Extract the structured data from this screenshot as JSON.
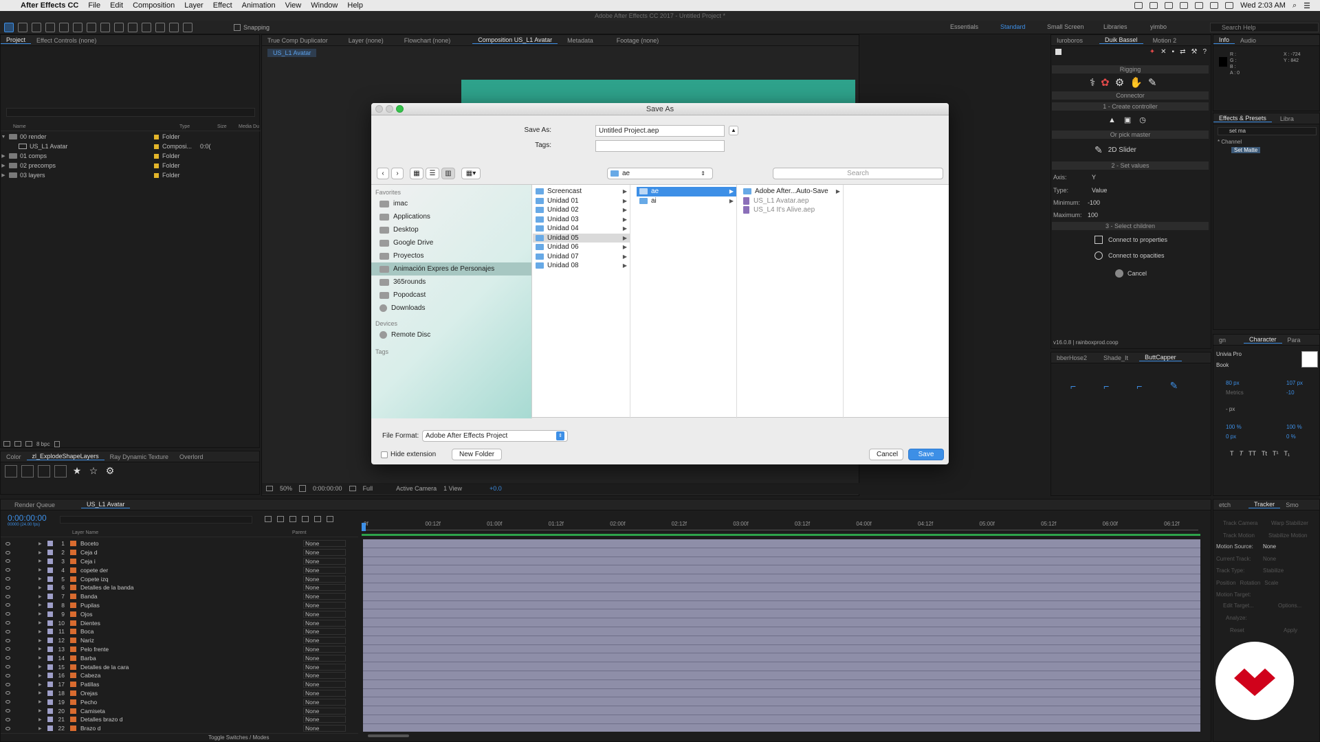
{
  "menubar": {
    "app_name": "After Effects CC",
    "menus": [
      "File",
      "Edit",
      "Composition",
      "Layer",
      "Effect",
      "Animation",
      "View",
      "Window",
      "Help"
    ],
    "clock": "Wed 2:03 AM"
  },
  "window_title": "Adobe After Effects CC 2017 - Untitled Project *",
  "toolbar": {
    "snapping_label": "Snapping",
    "workspaces": [
      "Essentials",
      "Standard",
      "Small Screen",
      "Libraries",
      "yimbo"
    ],
    "active_workspace": "Standard",
    "search_help_placeholder": "Search Help"
  },
  "project_panel": {
    "tabs": [
      "Project",
      "Effect Controls (none)"
    ],
    "columns": [
      "Name",
      "Type",
      "Size",
      "Media Du"
    ],
    "items": [
      {
        "name": "00 render",
        "type": "Folder",
        "size": "",
        "icon": "folder-icon",
        "indent": 0,
        "open": true
      },
      {
        "name": "US_L1 Avatar",
        "type": "Composi...",
        "size": "0:0(",
        "icon": "composition-icon",
        "indent": 1,
        "open": false
      },
      {
        "name": "01 comps",
        "type": "Folder",
        "size": "",
        "icon": "folder-icon",
        "indent": 0,
        "open": false
      },
      {
        "name": "02 precomps",
        "type": "Folder",
        "size": "",
        "icon": "folder-icon",
        "indent": 0,
        "open": false
      },
      {
        "name": "03 layers",
        "type": "Folder",
        "size": "",
        "icon": "folder-icon",
        "indent": 0,
        "open": false
      }
    ],
    "bpc": "8 bpc"
  },
  "effects_tabs": {
    "tabs": [
      "Color",
      "zl_ExplodeShapeLayers",
      "Ray Dynamic Texture",
      "Overlord"
    ],
    "active": "zl_ExplodeShapeLayers"
  },
  "viewer": {
    "tabs": [
      "True Comp Duplicator",
      "Layer (none)",
      "Flowchart (none)",
      "Composition US_L1 Avatar",
      "Metadata",
      "Footage (none)"
    ],
    "active_tab": "Composition US_L1 Avatar",
    "breadcrumb": "US_L1 Avatar",
    "bottom": {
      "zoom": "50%",
      "timecode": "0:00:00:00",
      "resolution": "Full",
      "camera": "Active Camera",
      "views": "1 View",
      "exposure": "+0.0"
    },
    "comp_color": "#2ea28b"
  },
  "dialog": {
    "title": "Save As",
    "save_as_label": "Save As:",
    "save_as_value": "Untitled Project.aep",
    "tags_label": "Tags:",
    "tags_value": "",
    "location": "ae",
    "search_placeholder": "Search",
    "sidebar": {
      "favorites_heading": "Favorites",
      "favorites": [
        "imac",
        "Applications",
        "Desktop",
        "Google Drive",
        "Proyectos",
        "Animación Expres de Personajes",
        "365rounds",
        "Popodcast",
        "Downloads"
      ],
      "selected": "Animación Expres de Personajes",
      "devices_heading": "Devices",
      "devices": [
        "Remote Disc"
      ],
      "tags_heading": "Tags"
    },
    "column1": {
      "items": [
        "Screencast",
        "Unidad 01",
        "Unidad 02",
        "Unidad 03",
        "Unidad 04",
        "Unidad 05",
        "Unidad 06",
        "Unidad 07",
        "Unidad 08"
      ],
      "selected": "Unidad 05"
    },
    "column2": {
      "items": [
        "ae",
        "ai"
      ],
      "selected": "ae"
    },
    "column3": {
      "items": [
        {
          "name": "Adobe After...Auto-Save",
          "kind": "folder"
        },
        {
          "name": "US_L1 Avatar.aep",
          "kind": "file"
        },
        {
          "name": "US_L4 It's Alive.aep",
          "kind": "file"
        }
      ]
    },
    "file_format_label": "File Format:",
    "file_format_value": "Adobe After Effects Project",
    "hide_extension_label": "Hide extension",
    "new_folder_label": "New Folder",
    "cancel_label": "Cancel",
    "save_label": "Save"
  },
  "duik": {
    "tabs": [
      "Iuroboros",
      "Duik Bassel",
      "Motion 2"
    ],
    "active": "Duik Bassel",
    "sections": {
      "rigging": "Rigging",
      "connector": "Connector",
      "step1": "1 - Create controller",
      "or_pick": "Or pick master",
      "slider": "2D Slider",
      "step2": "2 - Set values",
      "step3": "3 - Select children"
    },
    "axis_label": "Axis:",
    "axis_value": "Y",
    "type_label": "Type:",
    "type_value": "Value",
    "min_label": "Minimum:",
    "min_value": "-100",
    "max_label": "Maximum:",
    "max_value": "100",
    "connect_props": "Connect to properties",
    "connect_opacities": "Connect to opacities",
    "cancel": "Cancel",
    "version": "v16.0.8 | rainboxprod.coop"
  },
  "info_panel": {
    "tabs": [
      "Info",
      "Audio"
    ],
    "channels": [
      "R :",
      "G :",
      "B :",
      "A : 0"
    ],
    "x": "X : -724",
    "y": "Y : 842"
  },
  "effects_presets": {
    "tabs": [
      "Effects & Presets",
      "Libra"
    ],
    "search": "set ma",
    "category": "* Channel",
    "result": "Set Matte"
  },
  "buttcapper": {
    "tabs": [
      "bberHose2",
      "Shade_It",
      "ButtCapper"
    ],
    "active": "ButtCapper"
  },
  "character": {
    "tabs": [
      "gn",
      "Character",
      "Para"
    ],
    "font": "Univia Pro",
    "style": "Book",
    "size": "80 px",
    "leading": "107 px",
    "kerning": "Metrics",
    "tracking": "-10",
    "stroke": "- px",
    "vscale": "100 %",
    "hscale": "100 %",
    "baseline": "0 px",
    "tsume": "0 %"
  },
  "tracker": {
    "tabs": [
      "etch",
      "Tracker",
      "Smo"
    ],
    "buttons": [
      "Track Camera",
      "Warp Stabilizer",
      "Track Motion",
      "Stabilize Motion"
    ],
    "motion_source_label": "Motion Source:",
    "motion_source_value": "None",
    "current_track_label": "Current Track:",
    "current_track_value": "None",
    "track_type_label": "Track Type:",
    "track_type_value": "Stabilize",
    "checks": [
      "Position",
      "Rotation",
      "Scale"
    ],
    "motion_target": "Motion Target:",
    "edit_target": "Edit Target...",
    "options": "Options...",
    "analyze": "Analyze:",
    "reset": "Reset",
    "apply": "Apply"
  },
  "timeline": {
    "tabs": [
      "Render Queue",
      "US_L1 Avatar"
    ],
    "active_tab": "US_L1 Avatar",
    "timecode": "0:00:00:00",
    "fps": "00000 (24.00 fps)",
    "col_layer_name": "Layer Name",
    "col_parent": "Parent",
    "ruler": [
      "0f",
      "00:12f",
      "01:00f",
      "01:12f",
      "02:00f",
      "02:12f",
      "03:00f",
      "03:12f",
      "04:00f",
      "04:12f",
      "05:00f",
      "05:12f",
      "06:00f",
      "06:12f"
    ],
    "toggle_label": "Toggle Switches / Modes",
    "layers": [
      {
        "num": "1",
        "name": "Boceto",
        "parent": "None"
      },
      {
        "num": "2",
        "name": "Ceja d",
        "parent": "None"
      },
      {
        "num": "3",
        "name": "Ceja i",
        "parent": "None"
      },
      {
        "num": "4",
        "name": "copete der",
        "parent": "None"
      },
      {
        "num": "5",
        "name": "Copete izq",
        "parent": "None"
      },
      {
        "num": "6",
        "name": "Detalles de la banda",
        "parent": "None"
      },
      {
        "num": "7",
        "name": "Banda",
        "parent": "None"
      },
      {
        "num": "8",
        "name": "Pupilas",
        "parent": "None"
      },
      {
        "num": "9",
        "name": "Ojos",
        "parent": "None"
      },
      {
        "num": "10",
        "name": "Dientes",
        "parent": "None"
      },
      {
        "num": "11",
        "name": "Boca",
        "parent": "None"
      },
      {
        "num": "12",
        "name": "Nariz",
        "parent": "None"
      },
      {
        "num": "13",
        "name": "Pelo frente",
        "parent": "None"
      },
      {
        "num": "14",
        "name": "Barba",
        "parent": "None"
      },
      {
        "num": "15",
        "name": "Detalles de la cara",
        "parent": "None"
      },
      {
        "num": "16",
        "name": "Cabeza",
        "parent": "None"
      },
      {
        "num": "17",
        "name": "Patillas",
        "parent": "None"
      },
      {
        "num": "18",
        "name": "Orejas",
        "parent": "None"
      },
      {
        "num": "19",
        "name": "Pecho",
        "parent": "None"
      },
      {
        "num": "20",
        "name": "Camiseta",
        "parent": "None"
      },
      {
        "num": "21",
        "name": "Detalles brazo d",
        "parent": "None"
      },
      {
        "num": "22",
        "name": "Brazo d",
        "parent": "None"
      }
    ]
  },
  "colors": {
    "accent": "#3d8fe6",
    "brand_logo": "#d0021b",
    "track": "#8e8ea8",
    "label_yellow": "#e3b52a"
  }
}
